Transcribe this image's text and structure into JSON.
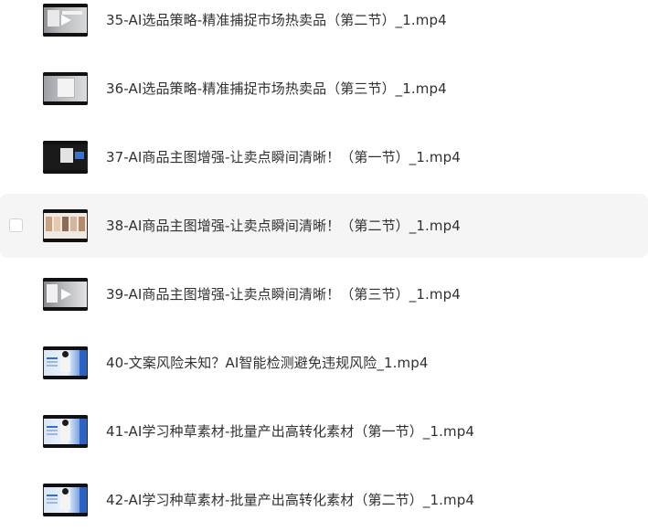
{
  "files": [
    {
      "name": "35-AI选品策略-精准捕捉市场热卖品（第二节）_1.mp4",
      "thumbnail": "video-thumbnail-grey-ui",
      "play_overlay": true
    },
    {
      "name": "36-AI选品策略-精准捕捉市场热卖品（第三节）_1.mp4",
      "thumbnail": "video-thumbnail-grey-dialog",
      "play_overlay": false
    },
    {
      "name": "37-AI商品主图增强-让卖点瞬间清晰！（第一节）_1.mp4",
      "thumbnail": "video-thumbnail-dark",
      "play_overlay": false
    },
    {
      "name": "38-AI商品主图增强-让卖点瞬间清晰！（第二节）_1.mp4",
      "thumbnail": "video-thumbnail-product-tiles",
      "play_overlay": false
    },
    {
      "name": "39-AI商品主图增强-让卖点瞬间清晰！（第三节）_1.mp4",
      "thumbnail": "video-thumbnail-grey-ui",
      "play_overlay": true
    },
    {
      "name": "40-文案风险未知？AI智能检测避免违规风险_1.mp4",
      "thumbnail": "video-thumbnail-presenter-blue",
      "play_overlay": false
    },
    {
      "name": "41-AI学习种草素材-批量产出高转化素材（第一节）_1.mp4",
      "thumbnail": "video-thumbnail-presenter-blue",
      "play_overlay": false
    },
    {
      "name": "42-AI学习种草素材-批量产出高转化素材（第二节）_1.mp4",
      "thumbnail": "video-thumbnail-presenter-blue",
      "play_overlay": false
    }
  ],
  "hovered_row_index": 3,
  "colors": {
    "text": "#303133",
    "hover_background": "#f5f5f6",
    "checkbox_border": "#cfd3da",
    "accent_blue": "#2f6fd0"
  }
}
